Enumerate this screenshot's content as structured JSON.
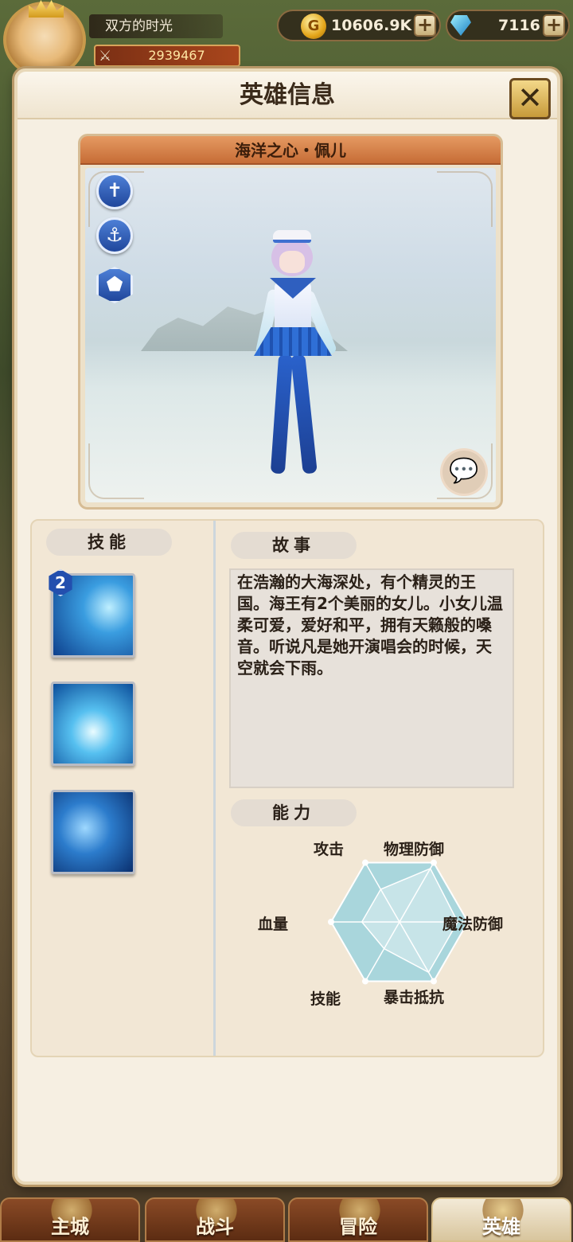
{
  "topbar": {
    "player_name": "双方的时光",
    "power": "2939467",
    "gold": "10606.9K",
    "gems": "7116",
    "gold_icon_char": "G",
    "plus": "+"
  },
  "panel": {
    "title": "英雄信息",
    "close_label": "✕"
  },
  "hero": {
    "name": "海洋之心・佩儿",
    "badges": [
      {
        "icon": "cross-icon",
        "glyph": "✝"
      },
      {
        "icon": "anchor-icon",
        "glyph": "⚓"
      },
      {
        "icon": "boot-icon",
        "glyph": "⬟"
      }
    ],
    "chat_glyph": "💬"
  },
  "skills": {
    "header": "技能",
    "items": [
      {
        "level": "2"
      },
      {
        "level": ""
      },
      {
        "level": ""
      }
    ]
  },
  "story": {
    "header": "故事",
    "text": "在浩瀚的大海深处，有个精灵的王国。海王有2个美丽的女儿。小女儿温柔可爱，爱好和平，拥有天籁般的嗓音。听说凡是她开演唱会的时候，天空就会下雨。"
  },
  "ability": {
    "header": "能力",
    "axes": [
      "攻击",
      "物理防御",
      "魔法防御",
      "暴击抵抗",
      "技能",
      "血量"
    ],
    "values": [
      0.55,
      0.9,
      0.85,
      0.85,
      0.45,
      0.55
    ]
  },
  "nav": {
    "items": [
      {
        "label": "主城"
      },
      {
        "label": "战斗"
      },
      {
        "label": "冒险"
      },
      {
        "label": "英雄"
      }
    ],
    "active": "英雄"
  },
  "colors": {
    "accent": "#c66c36",
    "panel_bg": "#f6efe2",
    "radar_fill": "#a9d6dc"
  }
}
